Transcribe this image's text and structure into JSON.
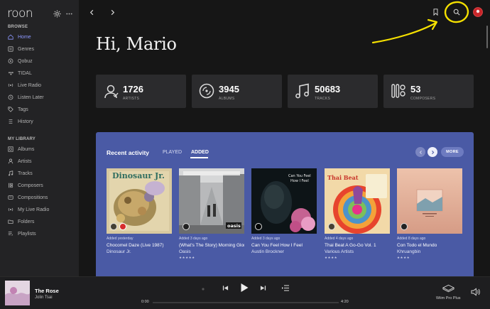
{
  "app": {
    "logo": "roon"
  },
  "sidebar": {
    "browse_title": "BROWSE",
    "browse_items": [
      {
        "label": "Home",
        "icon": "home-icon",
        "active": true
      },
      {
        "label": "Genres",
        "icon": "genres-icon"
      },
      {
        "label": "Qobuz",
        "icon": "qobuz-icon"
      },
      {
        "label": "TIDAL",
        "icon": "tidal-icon"
      },
      {
        "label": "Live Radio",
        "icon": "radio-icon"
      },
      {
        "label": "Listen Later",
        "icon": "clock-icon"
      },
      {
        "label": "Tags",
        "icon": "tag-icon"
      },
      {
        "label": "History",
        "icon": "history-icon"
      }
    ],
    "library_title": "MY LIBRARY",
    "library_items": [
      {
        "label": "Albums",
        "icon": "album-icon"
      },
      {
        "label": "Artists",
        "icon": "artist-icon"
      },
      {
        "label": "Tracks",
        "icon": "music-note-icon"
      },
      {
        "label": "Composers",
        "icon": "composer-icon"
      },
      {
        "label": "Compositions",
        "icon": "composition-icon"
      },
      {
        "label": "My Live Radio",
        "icon": "radio-icon"
      },
      {
        "label": "Folders",
        "icon": "folder-icon"
      },
      {
        "label": "Playlists",
        "icon": "playlist-icon"
      }
    ]
  },
  "main": {
    "greeting": "Hi, Mario",
    "stats": [
      {
        "value": "1726",
        "label": "ARTISTS",
        "icon": "artist-icon"
      },
      {
        "value": "3945",
        "label": "ALBUMS",
        "icon": "album-icon"
      },
      {
        "value": "50683",
        "label": "TRACKS",
        "icon": "music-note-icon"
      },
      {
        "value": "53",
        "label": "COMPOSERS",
        "icon": "composer-icon"
      }
    ],
    "recent": {
      "title": "Recent activity",
      "tab_played": "PLAYED",
      "tab_added": "ADDED",
      "more": "MORE",
      "albums": [
        {
          "added": "Added yesterday",
          "title": "Chocomel Daze (Live 1987)",
          "artist": "Dinosaur Jr.",
          "stars": "",
          "cover_text": "Dinosaur Jr."
        },
        {
          "added": "Added 3 days ago",
          "title": "(What's The Story) Morning Glory?",
          "artist": "Oasis",
          "stars": "★★★★★",
          "cover_text": "oasis"
        },
        {
          "added": "Added 3 days ago",
          "title": "Can You Feel How I Feel",
          "artist": "Austin Brockner",
          "stars": "",
          "cover_text": "Can You Feel How I Feel"
        },
        {
          "added": "Added 4 days ago",
          "title": "Thai Beat A Go-Go Vol. 1",
          "artist": "Various Artists",
          "stars": "★★★★",
          "cover_text": "Thai Beat"
        },
        {
          "added": "Added 8 days ago",
          "title": "Con Todo el Mundo",
          "artist": "Khruangbin",
          "stars": "★★★★",
          "cover_text": ""
        }
      ]
    }
  },
  "player": {
    "title": "The Rose",
    "artist": "Jolin Tsai",
    "time_current": "0:00",
    "time_total": "4:20",
    "zone": "Wiim Pro Plus"
  },
  "colors": {
    "accent": "#8d98ff",
    "recent_panel": "#4a5aa5",
    "annotation": "#f5e000"
  }
}
